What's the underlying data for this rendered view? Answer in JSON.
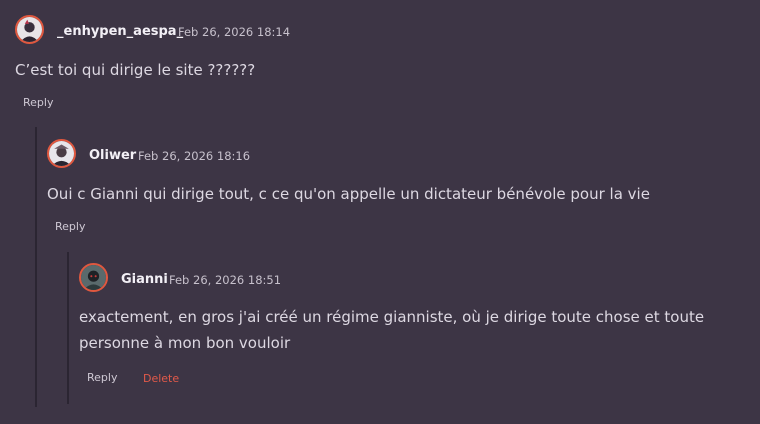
{
  "comments": [
    {
      "username": "_enhypen_aespa_",
      "timestamp": "Feb 26, 2026 18:14",
      "text": "C’est toi qui dirige le site ??????",
      "reply_label": "Reply",
      "avatar_icon": "user-avatar-icon"
    },
    {
      "username": "Oliwer",
      "timestamp": "Feb 26, 2026 18:16",
      "text": "Oui c Gianni qui dirige tout, c ce qu'on appelle un dictateur bénévole pour la vie",
      "reply_label": "Reply",
      "avatar_icon": "user-avatar-icon"
    },
    {
      "username": "Gianni",
      "timestamp": "Feb 26, 2026 18:51",
      "text": "exactement, en gros j'ai créé un régime gianniste, où je dirige toute chose et toute personne à mon bon vouloir",
      "reply_label": "Reply",
      "delete_label": "Delete",
      "avatar_icon": "user-avatar-icon"
    }
  ],
  "colors": {
    "background": "#3d3545",
    "thread_line": "#2b2532",
    "avatar_border": "#e0583f",
    "delete": "#e35a4a"
  }
}
